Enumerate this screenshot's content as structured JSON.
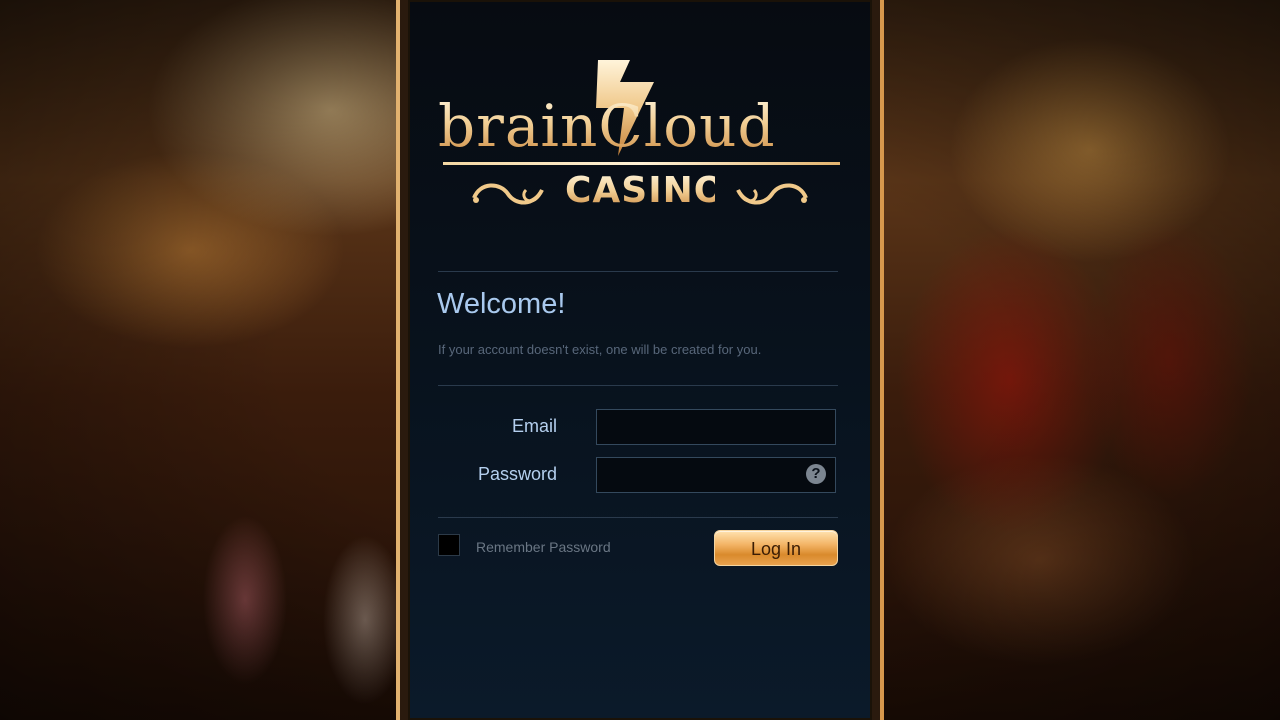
{
  "logo": {
    "brand": "brainCloud",
    "subtitle": "CASINO"
  },
  "welcome": {
    "title": "Welcome!",
    "subtitle": "If your account doesn't exist, one will be created for you."
  },
  "form": {
    "email_label": "Email",
    "email_value": "",
    "password_label": "Password",
    "password_value": "",
    "help_icon": "question-mark-icon",
    "help_glyph": "?",
    "remember_label": "Remember Password",
    "remember_checked": false,
    "login_label": "Log In"
  },
  "colors": {
    "accent_gold": "#e9a24e",
    "panel_bg": "#08121d",
    "label_blue": "#b4cfee"
  }
}
